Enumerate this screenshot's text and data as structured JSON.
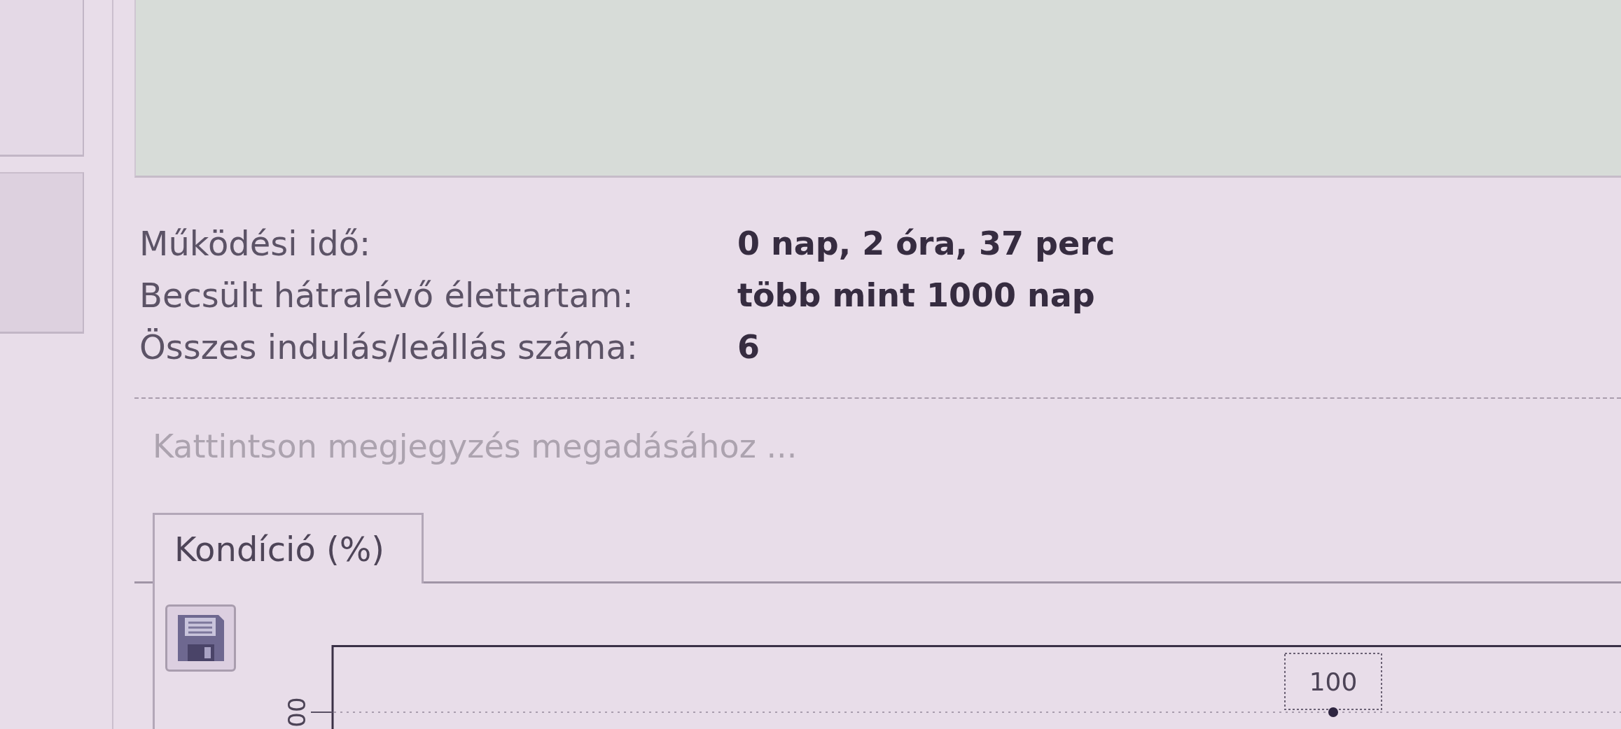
{
  "stats": [
    {
      "label": "Működési idő:",
      "value": "0 nap, 2 óra, 37 perc"
    },
    {
      "label": "Becsült hátralévő élettartam:",
      "value": "több mint 1000 nap"
    },
    {
      "label": "Összes indulás/leállás száma:",
      "value": "6"
    }
  ],
  "note": {
    "placeholder": "Kattintson megjegyzés megadásához ..."
  },
  "tabs": [
    {
      "label": "Kondíció (%)",
      "selected": true
    }
  ],
  "tab_panel": {
    "y_axis_label": "00",
    "point_label": "100"
  }
}
